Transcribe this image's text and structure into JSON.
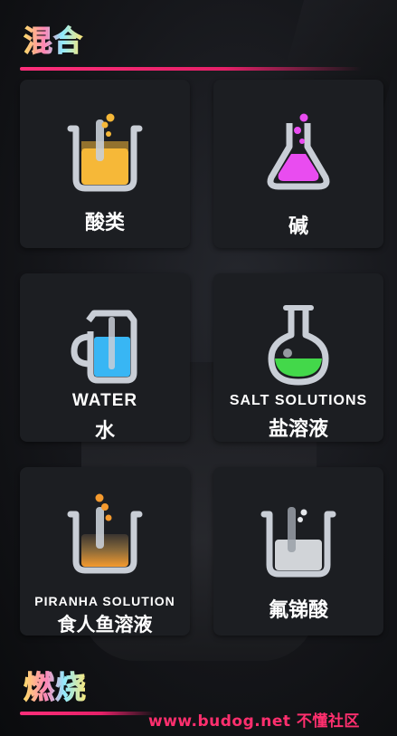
{
  "sections": {
    "mix_title": "混合",
    "burn_title": "燃烧"
  },
  "items": [
    {
      "label_cn": "酸类",
      "label_en": "",
      "icon": "beaker-icon",
      "liquid": "#f6b838"
    },
    {
      "label_cn": "碱",
      "label_en": "",
      "icon": "erlenmeyer-flask-icon",
      "liquid": "#e94cf0"
    },
    {
      "label_cn": "水",
      "label_en": "WATER",
      "icon": "jug-icon",
      "liquid": "#38b6f4"
    },
    {
      "label_cn": "盐溶液",
      "label_en": "SALT SOLUTIONS",
      "icon": "round-flask-icon",
      "liquid": "#43d84a"
    },
    {
      "label_cn": "食人鱼溶液",
      "label_en": "PIRANHA SOLUTION",
      "icon": "beaker-icon",
      "liquid": "#f59a2e"
    },
    {
      "label_cn": "氟锑酸",
      "label_en": "",
      "icon": "beaker-icon",
      "liquid": "#e6e8ec"
    }
  ],
  "watermark": "www.budog.net 不懂社区",
  "colors": {
    "accent": "#e52068",
    "card_bg": "#1c1e22",
    "glass": "#c9ced6"
  }
}
